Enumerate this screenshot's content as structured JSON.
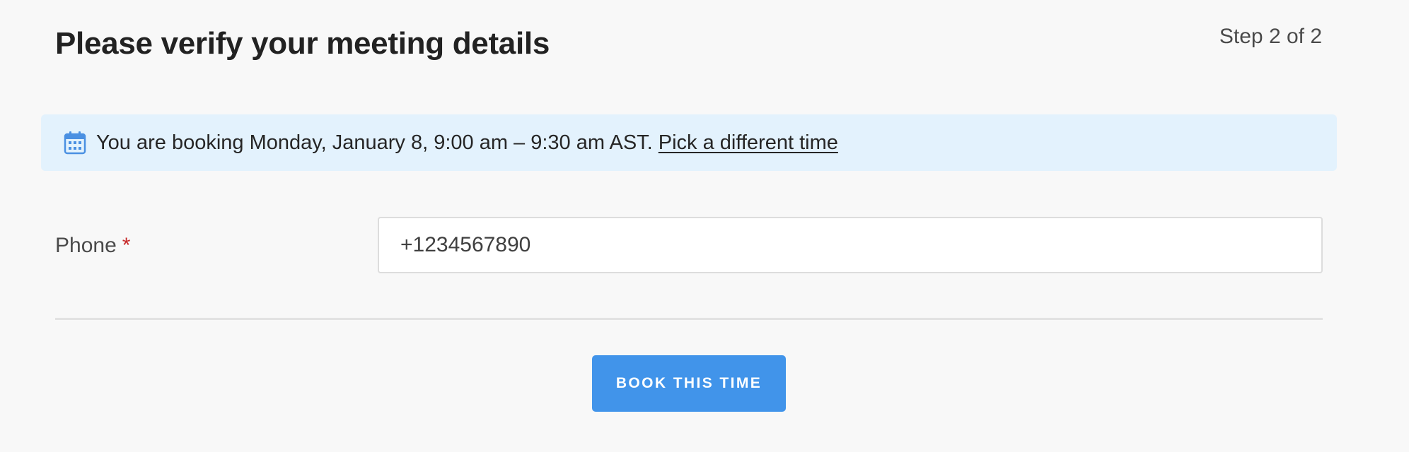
{
  "header": {
    "title": "Please verify your meeting details",
    "step": "Step 2 of 2"
  },
  "banner": {
    "icon": "calendar-icon",
    "message": "You are booking Monday, January 8, 9:00 am – 9:30 am AST.",
    "link_label": "Pick a different time"
  },
  "form": {
    "phone": {
      "label": "Phone",
      "required_mark": "*",
      "value": "+1234567890"
    }
  },
  "actions": {
    "book_label": "BOOK THIS TIME"
  },
  "colors": {
    "accent": "#4194ea",
    "banner_background": "#e3f2fd",
    "required": "#c62828",
    "page_background": "#f8f8f8"
  }
}
